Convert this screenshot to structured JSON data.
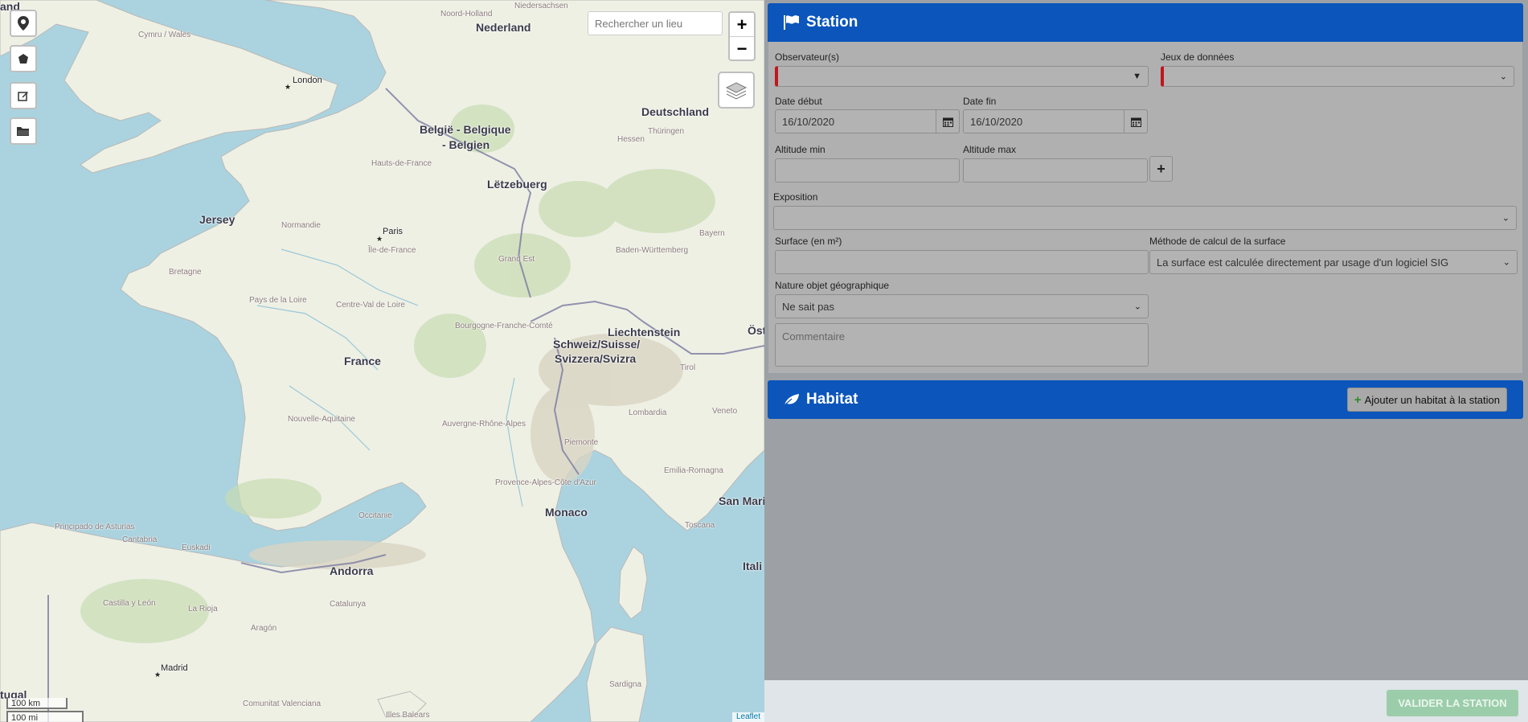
{
  "map": {
    "search_placeholder": "Rechercher un lieu",
    "zoom_in": "+",
    "zoom_out": "−",
    "scale_km": "100 km",
    "scale_mi": "100 mi",
    "attribution": "Leaflet",
    "labels": {
      "england": "and",
      "nederland": "Nederland",
      "belgie": "België - Belgique",
      "belgien": "- Belgien",
      "deutschland": "Deutschland",
      "letzebuerg": "Lëtzebuerg",
      "london": "London",
      "paris": "Paris",
      "jersey": "Jersey",
      "france": "France",
      "liechtenstein": "Liechtenstein",
      "schweiz": "Schweiz/Suisse/",
      "svizzera": "Svizzera/Svizra",
      "monaco": "Monaco",
      "andorra": "Andorra",
      "madrid": "Madrid",
      "san_marino": "San Mari",
      "italia": "Itali",
      "ost": "Öst",
      "portugal": "tugal",
      "noord_holland": "Noord-Holland",
      "cymru": "Cymru / Wales",
      "niedersachsen": "Niedersachsen",
      "bretagne": "Bretagne",
      "normandie": "Normandie",
      "ile_de_france": "Île-de-France",
      "grand_est": "Grand Est",
      "pays_de_la_loire": "Pays de la Loire",
      "centre_val": "Centre-Val de Loire",
      "bourgogne": "Bourgogne-Franche-Comté",
      "nouvelle_aquitaine": "Nouvelle-Aquitaine",
      "auvergne": "Auvergne-Rhône-Alpes",
      "occitanie": "Occitanie",
      "provence": "Provence-Alpes-Côte d'Azur",
      "lombardia": "Lombardia",
      "piemonte": "Piemonte",
      "toscana": "Toscana",
      "cataluna": "Catalunya",
      "aragon": "Aragón",
      "castilla": "Castilla y León",
      "principado": "Principado de Asturias",
      "cantabria": "Cantabria",
      "euskadi": "Euskadi",
      "la_rioja": "La Rioja",
      "sardegna": "Sardigna",
      "hauts_de_france": "Hauts-de-France",
      "baden": "Baden-Württemberg",
      "bayern": "Bayern",
      "hessen": "Hessen",
      "thuringen": "Thüringen",
      "emilia": "Emilia-Romagna",
      "veneto": "Veneto",
      "tirol": "Tirol",
      "illes_balears": "Illes Balears",
      "comunitat": "Comunitat Valenciana"
    }
  },
  "station": {
    "title": "Station",
    "observateurs_label": "Observateur(s)",
    "jeux_label": "Jeux de données",
    "date_debut_label": "Date début",
    "date_debut_value": "16/10/2020",
    "date_fin_label": "Date fin",
    "date_fin_value": "16/10/2020",
    "altitude_min_label": "Altitude min",
    "altitude_max_label": "Altitude max",
    "exposition_label": "Exposition",
    "surface_label": "Surface (en m²)",
    "methode_label": "Méthode de calcul de la surface",
    "methode_value": "La surface est calculée directement par usage d'un logiciel SIG",
    "nature_label": "Nature objet géographique",
    "nature_value": "Ne sait pas",
    "commentaire_placeholder": "Commentaire"
  },
  "habitat": {
    "title": "Habitat",
    "add_label": "Ajouter un habitat à la station"
  },
  "footer": {
    "validate_label": "VALIDER LA STATION"
  },
  "colors": {
    "header_blue": "#0b55bb",
    "required_red": "#c0161d",
    "validate_green": "#9ccdaa",
    "sea": "#aad3df",
    "land": "#f2efe9"
  }
}
